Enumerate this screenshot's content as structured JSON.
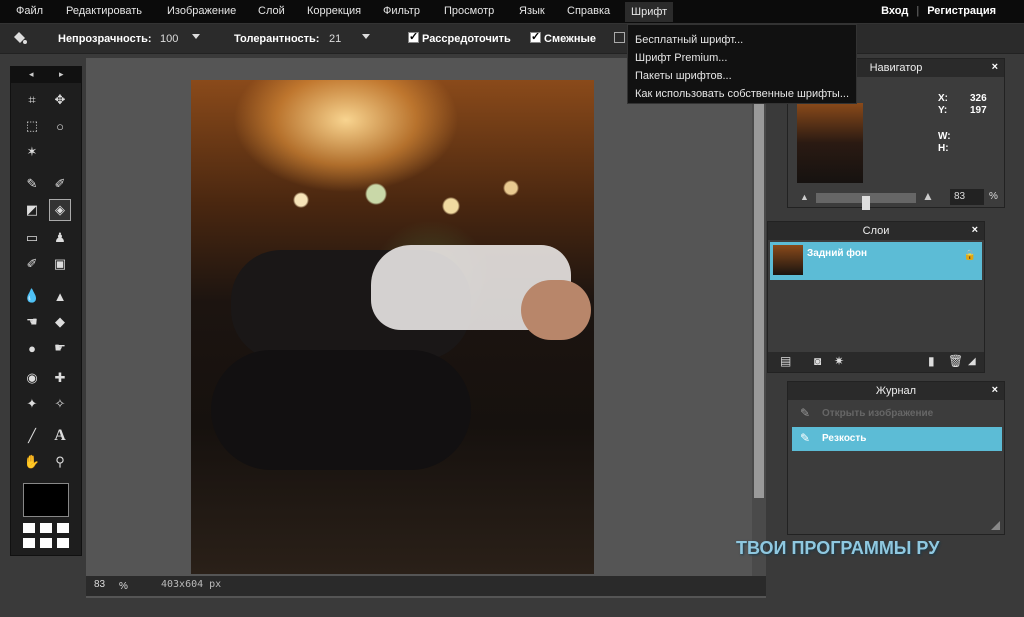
{
  "menu": {
    "items": [
      "Файл",
      "Редактировать",
      "Изображение",
      "Слой",
      "Коррекция",
      "Фильтр",
      "Просмотр",
      "Язык",
      "Справка",
      "Шрифт"
    ],
    "login": "Вход",
    "separator": "|",
    "register": "Регистрация"
  },
  "options": {
    "opacity_label": "Непрозрачность:",
    "opacity_value": "100",
    "tolerance_label": "Толерантность:",
    "tolerance_value": "21",
    "antialias_label": "Рассредоточить",
    "contiguous_label": "Смежные"
  },
  "font_menu": {
    "items": [
      "Бесплатный шрифт...",
      "Шрифт Premium...",
      "Пакеты шрифтов...",
      "Как использовать собственные шрифты..."
    ]
  },
  "toolbox": {
    "arrow_left": "◂",
    "arrow_right": "▸",
    "foreground_color": "#000000",
    "selected_tool": "paint-bucket-icon"
  },
  "status": {
    "zoom": "83",
    "zoom_unit": "%",
    "dimensions": "403x604 px"
  },
  "navigator": {
    "title": "Навигатор",
    "close": "×",
    "x_label": "X:",
    "x_value": "326",
    "y_label": "Y:",
    "y_value": "197",
    "w_label": "W:",
    "h_label": "H:",
    "zoom_value": "83",
    "zoom_unit": "%"
  },
  "layers": {
    "title": "Слои",
    "close": "×",
    "items": [
      {
        "name": "Задний фон"
      }
    ]
  },
  "journal": {
    "title": "Журнал",
    "close": "×",
    "items": [
      {
        "label": "Открыть изображение"
      },
      {
        "label": "Резкость"
      }
    ]
  },
  "watermark": "ТВОИ ПРОГРАММЫ РУ",
  "colors": {
    "accent": "#5cbcd6",
    "menubar": "#0b0b0b",
    "panel": "#3c3c3c"
  }
}
